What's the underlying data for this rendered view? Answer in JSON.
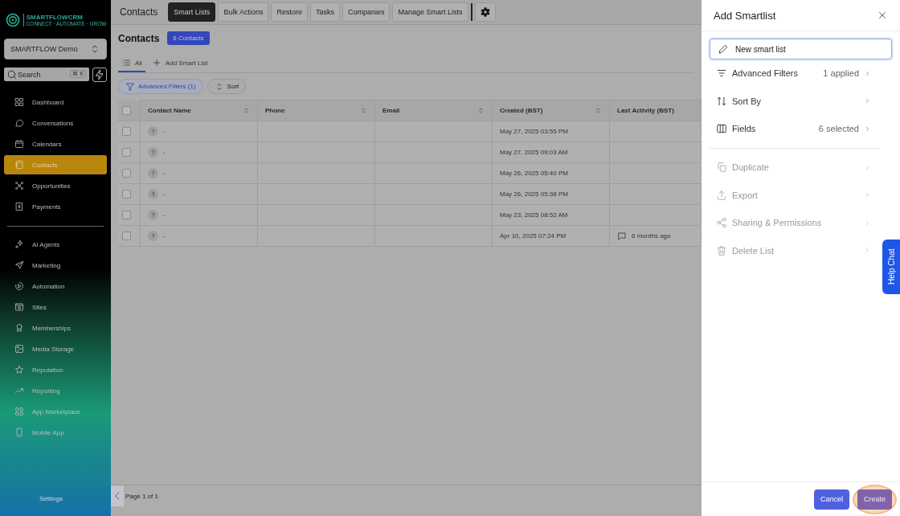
{
  "sidebar": {
    "logo": {
      "name": "SMARTFLOWCRM",
      "tagline": "CONNECT · AUTOMATE · GROW"
    },
    "account": "SMARTFLOW Demo",
    "search": {
      "placeholder": "Search",
      "shortcut": "⌘ K"
    },
    "sections": [
      {
        "items": [
          {
            "label": "Dashboard",
            "selected": false
          },
          {
            "label": "Conversations",
            "selected": false
          },
          {
            "label": "Calendars",
            "selected": false
          },
          {
            "label": "Contacts",
            "selected": true
          },
          {
            "label": "Opportunities",
            "selected": false
          },
          {
            "label": "Payments",
            "selected": false
          }
        ]
      },
      {
        "items": [
          {
            "label": "AI Agents",
            "selected": false
          },
          {
            "label": "Marketing",
            "selected": false
          },
          {
            "label": "Automation",
            "selected": false
          },
          {
            "label": "Sites",
            "selected": false
          },
          {
            "label": "Memberships",
            "selected": false
          },
          {
            "label": "Media Storage",
            "selected": false
          },
          {
            "label": "Reputation",
            "selected": false
          },
          {
            "label": "Reporting",
            "selected": false
          },
          {
            "label": "App Marketplace",
            "selected": false
          },
          {
            "label": "Mobile App",
            "selected": false
          }
        ]
      }
    ],
    "settings": "Settings"
  },
  "topbar": {
    "title": "Contacts",
    "tabs": [
      {
        "label": "Smart Lists",
        "selected": true
      },
      {
        "label": "Bulk Actions",
        "selected": false
      },
      {
        "label": "Restore",
        "selected": false
      },
      {
        "label": "Tasks",
        "selected": false
      },
      {
        "label": "Companies",
        "selected": false
      },
      {
        "label": "Manage Smart Lists",
        "selected": false
      }
    ]
  },
  "header": {
    "title": "Contacts",
    "count": "6 Contacts"
  },
  "list_tabs": [
    {
      "label": "All",
      "selected": true
    },
    {
      "label": "Add Smart List",
      "selected": false
    }
  ],
  "filters": {
    "advanced": "Advanced Filters (1)",
    "sort": "Sort"
  },
  "table": {
    "all_checked": false,
    "columns": [
      {
        "label": "Contact Name",
        "sortable": true
      },
      {
        "label": "Phone",
        "sortable": true
      },
      {
        "label": "Email",
        "sortable": true
      },
      {
        "label": "Created (BST)",
        "sortable": true
      },
      {
        "label": "Last Activity (BST)",
        "sortable": false
      }
    ],
    "rows": [
      {
        "checked": false,
        "avatar": "?",
        "name": "-",
        "created": "May 27, 2025  03:55 PM"
      },
      {
        "checked": false,
        "avatar": "?",
        "name": "-",
        "created": "May 27, 2025  09:03 AM"
      },
      {
        "checked": false,
        "avatar": "?",
        "name": "-",
        "created": "May 26, 2025  05:40 PM"
      },
      {
        "checked": false,
        "avatar": "?",
        "name": "-",
        "created": "May 26, 2025  05:38 PM"
      },
      {
        "checked": false,
        "avatar": "?",
        "name": "-",
        "created": "May 23, 2025  08:52 AM"
      },
      {
        "checked": false,
        "avatar": "?",
        "name": "-",
        "created": "Apr 10, 2025  07:24 PM",
        "last_activity": "6 months ago"
      }
    ]
  },
  "pagination": "Page 1 of 1",
  "panel": {
    "title": "Add Smartlist",
    "name_value": "New smart list",
    "options": [
      {
        "label": "Advanced Filters",
        "value": "1 applied",
        "disabled": false
      },
      {
        "label": "Sort By",
        "disabled": false
      },
      {
        "label": "Fields",
        "value": "6 selected",
        "disabled": false
      },
      {
        "label": "Duplicate",
        "disabled": true
      },
      {
        "label": "Export",
        "disabled": true
      },
      {
        "label": "Sharing & Permissions",
        "disabled": true
      },
      {
        "label": "Delete List",
        "disabled": true
      }
    ],
    "cancel": "Cancel",
    "create": "Create"
  },
  "help_chat": "Help Chat"
}
